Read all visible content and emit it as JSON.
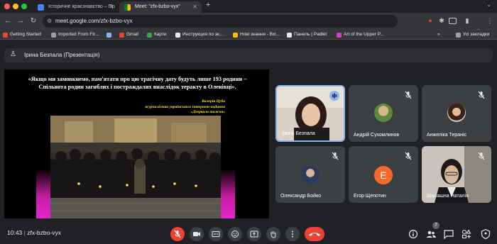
{
  "browser": {
    "tabs": [
      {
        "title": "Історичне краєзнавство – Пр"
      },
      {
        "title": "Meet: \"zfx-bzbo-vyx\""
      }
    ],
    "new_tab_symbol": "+",
    "url": "meet.google.com/zfx-bzbo-vyx",
    "bookmarks": [
      {
        "label": "Getting Started",
        "color": "#ea4335"
      },
      {
        "label": "Imported From Fir...",
        "color": "#9aa0a6"
      },
      {
        "label": "",
        "color": "#8ab4f8"
      },
      {
        "label": "Gmail",
        "color": "#ea4335"
      },
      {
        "label": "Карти",
        "color": "#34a853"
      },
      {
        "label": "Инструкция по эк...",
        "color": "#e8eaed"
      },
      {
        "label": "Нові знання - Вхі...",
        "color": "#fbbc04"
      },
      {
        "label": "Панель | Padlet",
        "color": "#e8eaed"
      },
      {
        "label": "Art of the Upper P...",
        "color": "#d93ebf"
      }
    ],
    "bookmarks_more": "»",
    "all_bookmarks": "Усі закладки"
  },
  "meet": {
    "presenter_label": "Ірина Безпала (Презентація)",
    "slide": {
      "quote": "«Якщо ми замовкнемо, пам'ятати про цю трагічну дату будуть лише 193 родини – Спільнота родин загиблих і постраждалих внаслідок теракту в Оленівці».",
      "author_name": "Валерія Цуба",
      "author_role": "журналістка українського інтернет-видання",
      "author_outlet": "«Дзеркало тижня»"
    },
    "participants": [
      {
        "name": "Ірина Безпала",
        "state": "speaking"
      },
      {
        "name": "Андрій Сухомлинов",
        "state": "muted"
      },
      {
        "name": "Анжеліка Тераніс",
        "state": "muted"
      },
      {
        "name": "Олександр Бойко",
        "state": "muted"
      },
      {
        "name": "Егор Щепотин",
        "state": "muted",
        "initial": "E"
      },
      {
        "name": "Шалашна Наталія",
        "state": "muted"
      }
    ],
    "time": "10:43",
    "meeting_code": "zfx-bzbo-vyx",
    "people_count": "7",
    "accent_red": "#ea4335",
    "accent_blue": "#8ab4f8"
  }
}
